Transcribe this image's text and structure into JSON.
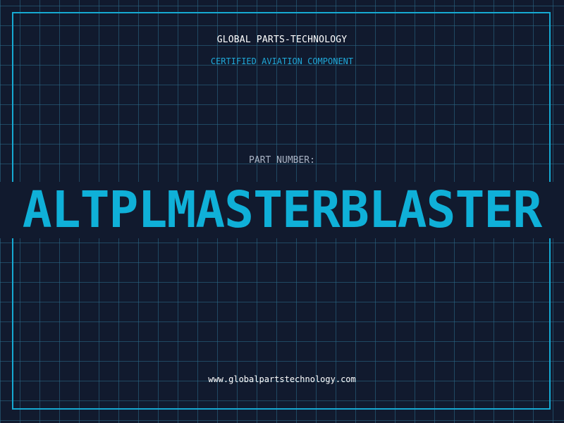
{
  "header": {
    "company": "GLOBAL PARTS-TECHNOLOGY",
    "tagline": "CERTIFIED AVIATION COMPONENT"
  },
  "part": {
    "label": "PART NUMBER:",
    "number": "ALTPLMASTERBLASTER"
  },
  "footer": {
    "website": "www.globalpartstechnology.com"
  },
  "colors": {
    "background": "#111a2e",
    "grid": "#2c6e8c",
    "accent": "#16a9d2",
    "text": "#ffffff",
    "label": "#a9b3c4"
  }
}
